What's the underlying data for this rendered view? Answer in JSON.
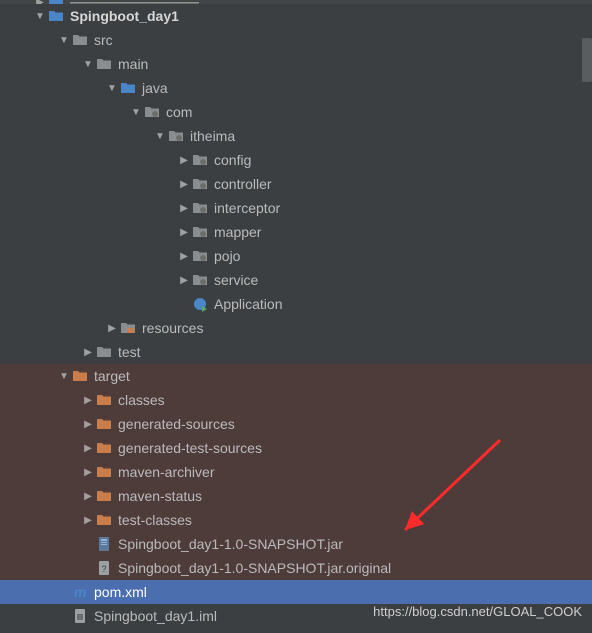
{
  "watermark": "https://blog.csdn.net/GLOAL_COOK",
  "rows": [
    {
      "indent": 32,
      "arrow": "right",
      "icon": "folder-blue",
      "labelPath": "truncated0",
      "bold": false,
      "state": "top-cut"
    },
    {
      "indent": 32,
      "arrow": "down",
      "icon": "folder-blue",
      "labelPath": "project",
      "bold": true
    },
    {
      "indent": 56,
      "arrow": "down",
      "icon": "folder-grey",
      "labelPath": "src",
      "bold": false
    },
    {
      "indent": 80,
      "arrow": "down",
      "icon": "folder-grey",
      "labelPath": "main",
      "bold": false
    },
    {
      "indent": 104,
      "arrow": "down",
      "icon": "folder-blue",
      "labelPath": "java",
      "bold": false
    },
    {
      "indent": 128,
      "arrow": "down",
      "icon": "package",
      "labelPath": "com",
      "bold": false
    },
    {
      "indent": 152,
      "arrow": "down",
      "icon": "package",
      "labelPath": "itheima",
      "bold": false
    },
    {
      "indent": 176,
      "arrow": "right",
      "icon": "package",
      "labelPath": "config",
      "bold": false
    },
    {
      "indent": 176,
      "arrow": "right",
      "icon": "package",
      "labelPath": "controller",
      "bold": false
    },
    {
      "indent": 176,
      "arrow": "right",
      "icon": "package",
      "labelPath": "interceptor",
      "bold": false
    },
    {
      "indent": 176,
      "arrow": "right",
      "icon": "package",
      "labelPath": "mapper",
      "bold": false
    },
    {
      "indent": 176,
      "arrow": "right",
      "icon": "package",
      "labelPath": "pojo",
      "bold": false
    },
    {
      "indent": 176,
      "arrow": "right",
      "icon": "package",
      "labelPath": "service",
      "bold": false
    },
    {
      "indent": 176,
      "arrow": "none",
      "icon": "class-run",
      "labelPath": "application",
      "bold": false
    },
    {
      "indent": 104,
      "arrow": "right",
      "icon": "folder-resources",
      "labelPath": "resources",
      "bold": false
    },
    {
      "indent": 80,
      "arrow": "right",
      "icon": "folder-grey",
      "labelPath": "test",
      "bold": false
    },
    {
      "indent": 56,
      "arrow": "down",
      "icon": "folder-orange",
      "labelPath": "target",
      "bold": false,
      "state": "target-row"
    },
    {
      "indent": 80,
      "arrow": "right",
      "icon": "folder-orange",
      "labelPath": "classes",
      "bold": false,
      "state": "target-row"
    },
    {
      "indent": 80,
      "arrow": "right",
      "icon": "folder-orange",
      "labelPath": "generated_sources",
      "bold": false,
      "state": "target-row"
    },
    {
      "indent": 80,
      "arrow": "right",
      "icon": "folder-orange",
      "labelPath": "generated_test_sources",
      "bold": false,
      "state": "target-row"
    },
    {
      "indent": 80,
      "arrow": "right",
      "icon": "folder-orange",
      "labelPath": "maven_archiver",
      "bold": false,
      "state": "target-row"
    },
    {
      "indent": 80,
      "arrow": "right",
      "icon": "folder-orange",
      "labelPath": "maven_status",
      "bold": false,
      "state": "target-row"
    },
    {
      "indent": 80,
      "arrow": "right",
      "icon": "folder-orange",
      "labelPath": "test_classes",
      "bold": false,
      "state": "target-row"
    },
    {
      "indent": 80,
      "arrow": "none",
      "icon": "jar",
      "labelPath": "snapshot_jar",
      "bold": false,
      "state": "target-row"
    },
    {
      "indent": 80,
      "arrow": "none",
      "icon": "file-unknown",
      "labelPath": "snapshot_original",
      "bold": false,
      "state": "target-row"
    },
    {
      "indent": 56,
      "arrow": "none",
      "icon": "maven",
      "labelPath": "pom",
      "bold": false,
      "state": "selected"
    },
    {
      "indent": 56,
      "arrow": "none",
      "icon": "iml",
      "labelPath": "iml",
      "bold": false
    }
  ],
  "labels": {
    "truncated0": "─────────────",
    "project": "Spingboot_day1",
    "src": "src",
    "main": "main",
    "java": "java",
    "com": "com",
    "itheima": "itheima",
    "config": "config",
    "controller": "controller",
    "interceptor": "interceptor",
    "mapper": "mapper",
    "pojo": "pojo",
    "service": "service",
    "application": "Application",
    "resources": "resources",
    "test": "test",
    "target": "target",
    "classes": "classes",
    "generated_sources": "generated-sources",
    "generated_test_sources": "generated-test-sources",
    "maven_archiver": "maven-archiver",
    "maven_status": "maven-status",
    "test_classes": "test-classes",
    "snapshot_jar": "Spingboot_day1-1.0-SNAPSHOT.jar",
    "snapshot_original": "Spingboot_day1-1.0-SNAPSHOT.jar.original",
    "pom": "pom.xml",
    "iml": "Spingboot_day1.iml"
  }
}
